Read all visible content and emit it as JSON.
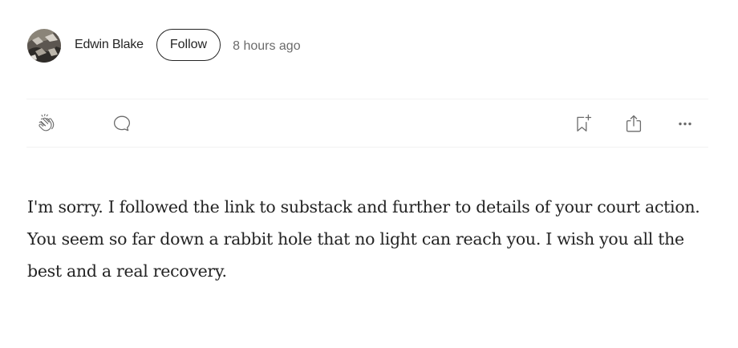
{
  "author": {
    "name": "Edwin Blake",
    "follow_label": "Follow",
    "timestamp": "8 hours ago"
  },
  "actions": {
    "clap_icon": "clap-icon",
    "reply_icon": "speech-bubble-icon",
    "bookmark_icon": "bookmark-add-icon",
    "share_icon": "share-icon",
    "more_icon": "more-dots-icon"
  },
  "response": {
    "paragraphs": [
      "I'm sorry. I followed the link to substack and further to details of your court action.",
      "You seem so far down a rabbit hole that no light can reach you. I wish you all the best and a real recovery."
    ]
  }
}
